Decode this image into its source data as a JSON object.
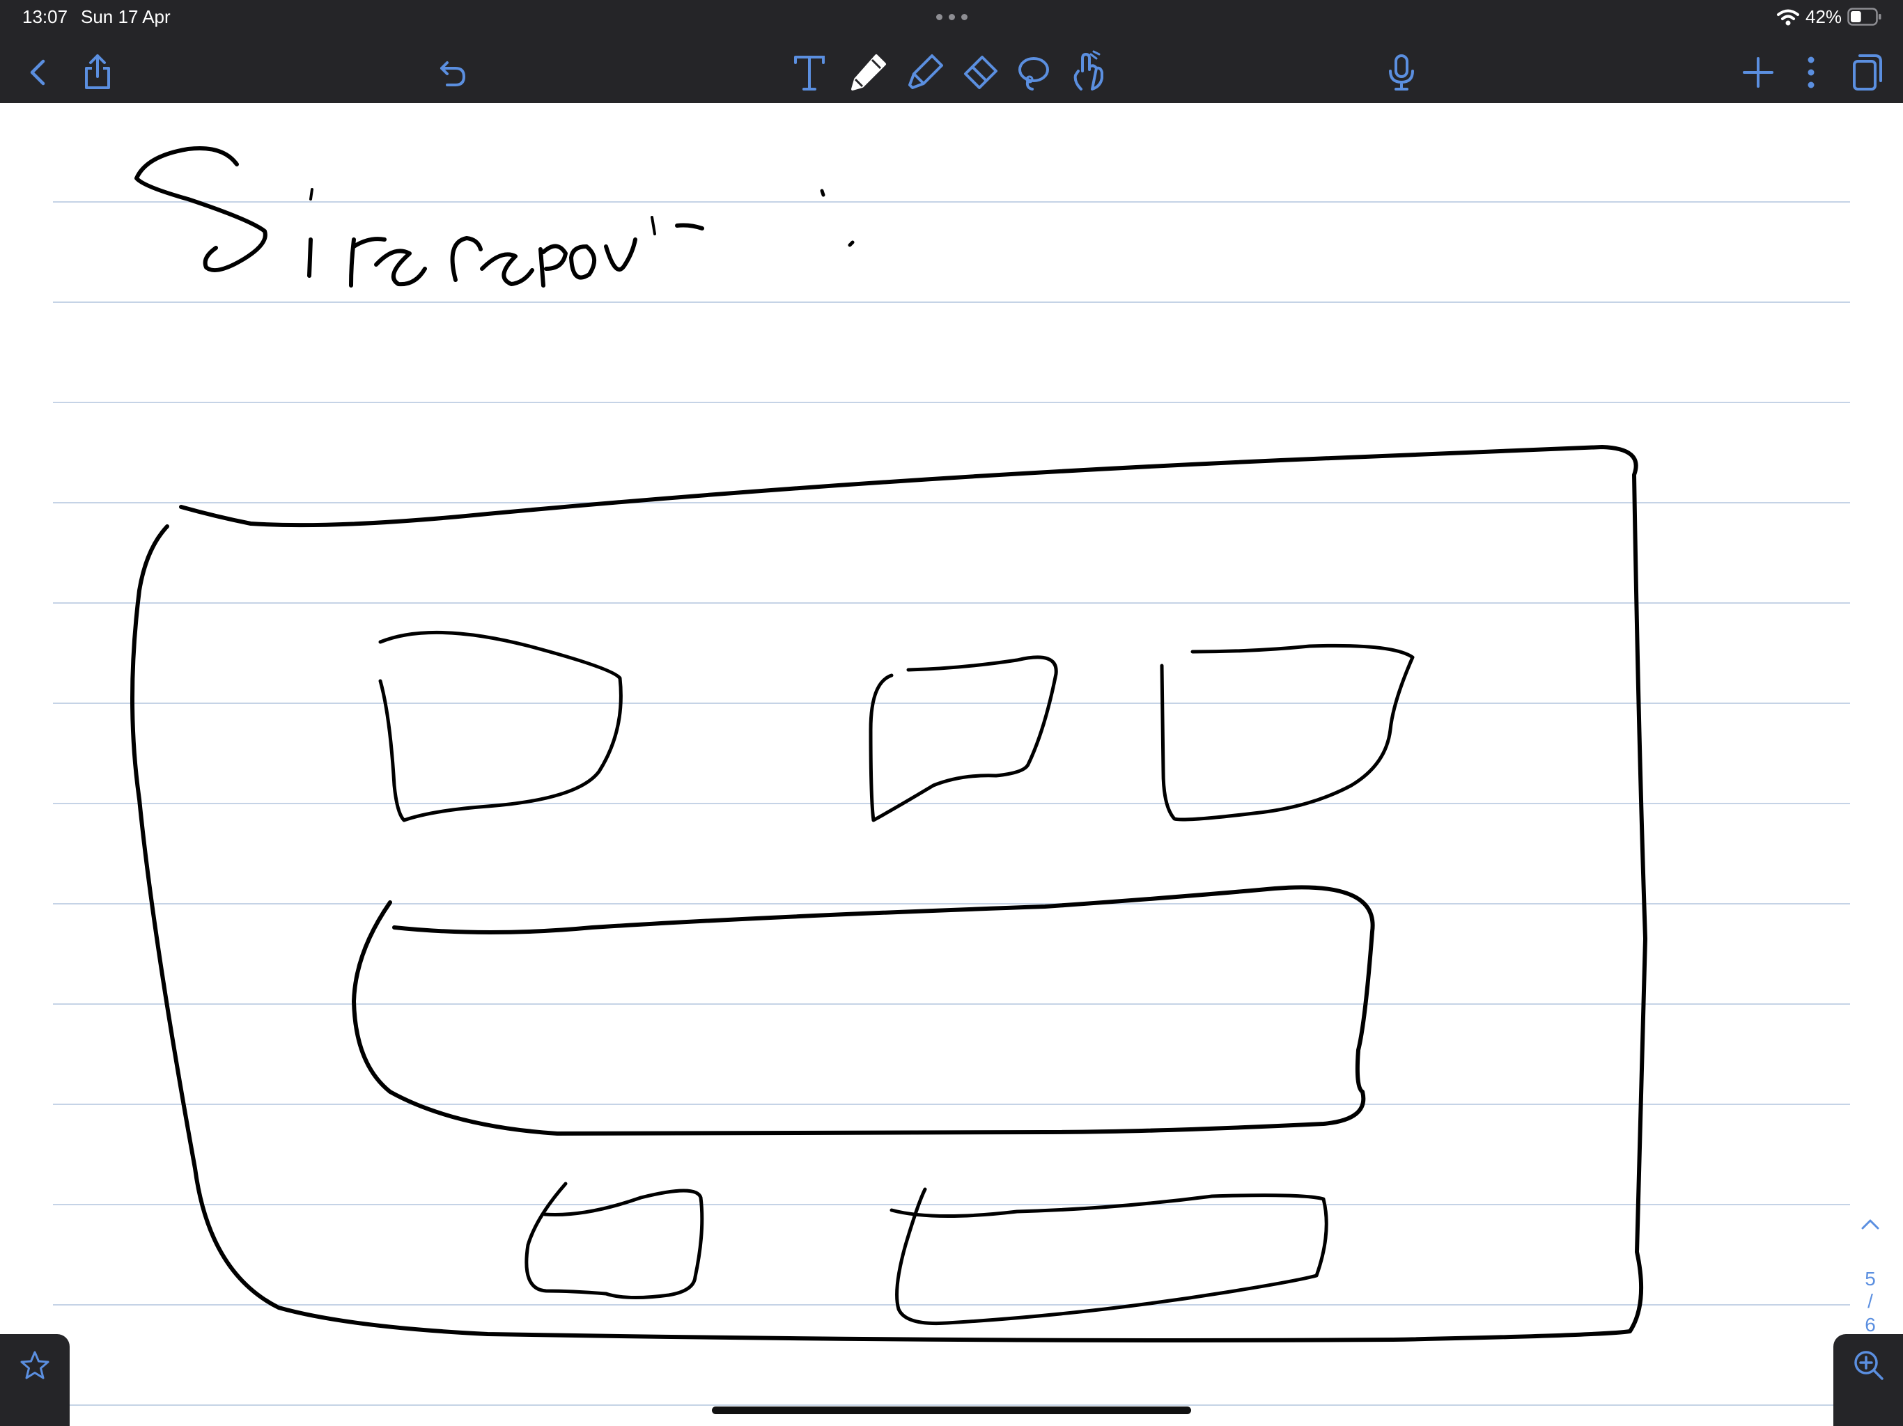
{
  "status_bar": {
    "time": "13:07",
    "date": "Sun 17 Apr",
    "battery_percent": "42%",
    "battery_level": 0.42,
    "wifi_icon": "wifi-icon"
  },
  "toolbar": {
    "left": [
      {
        "name": "back-button",
        "icon": "chevron-left-icon"
      },
      {
        "name": "share-button",
        "icon": "share-icon"
      },
      {
        "name": "undo-button",
        "icon": "undo-icon"
      }
    ],
    "tools": [
      {
        "name": "text-tool",
        "icon": "text-tool-icon"
      },
      {
        "name": "pen-tool",
        "icon": "pen-icon",
        "selected": true
      },
      {
        "name": "highlighter-tool",
        "icon": "highlighter-icon"
      },
      {
        "name": "eraser-tool",
        "icon": "eraser-icon"
      },
      {
        "name": "lasso-tool",
        "icon": "lasso-icon"
      },
      {
        "name": "hand-tool",
        "icon": "pointing-hand-icon"
      }
    ],
    "right": [
      {
        "name": "microphone-button",
        "icon": "microphone-icon"
      },
      {
        "name": "add-page-button",
        "icon": "plus-icon"
      },
      {
        "name": "more-button",
        "icon": "vertical-ellipsis-icon"
      },
      {
        "name": "pages-button",
        "icon": "pages-icon"
      }
    ]
  },
  "page_navigator": {
    "current": "5",
    "separator": "/",
    "total": "6",
    "up_icon": "chevron-up-icon",
    "down_icon": "chevron-down-icon"
  },
  "bottom": {
    "favorite_icon": "star-icon",
    "zoom_icon": "zoom-in-icon"
  },
  "note": {
    "paper_style": "lined",
    "handwritten_title": "Site report:"
  },
  "colors": {
    "toolbar_bg": "#252528",
    "accent": "#5b8fe0",
    "ruling": "#c5d3e6",
    "ink": "#000000"
  }
}
